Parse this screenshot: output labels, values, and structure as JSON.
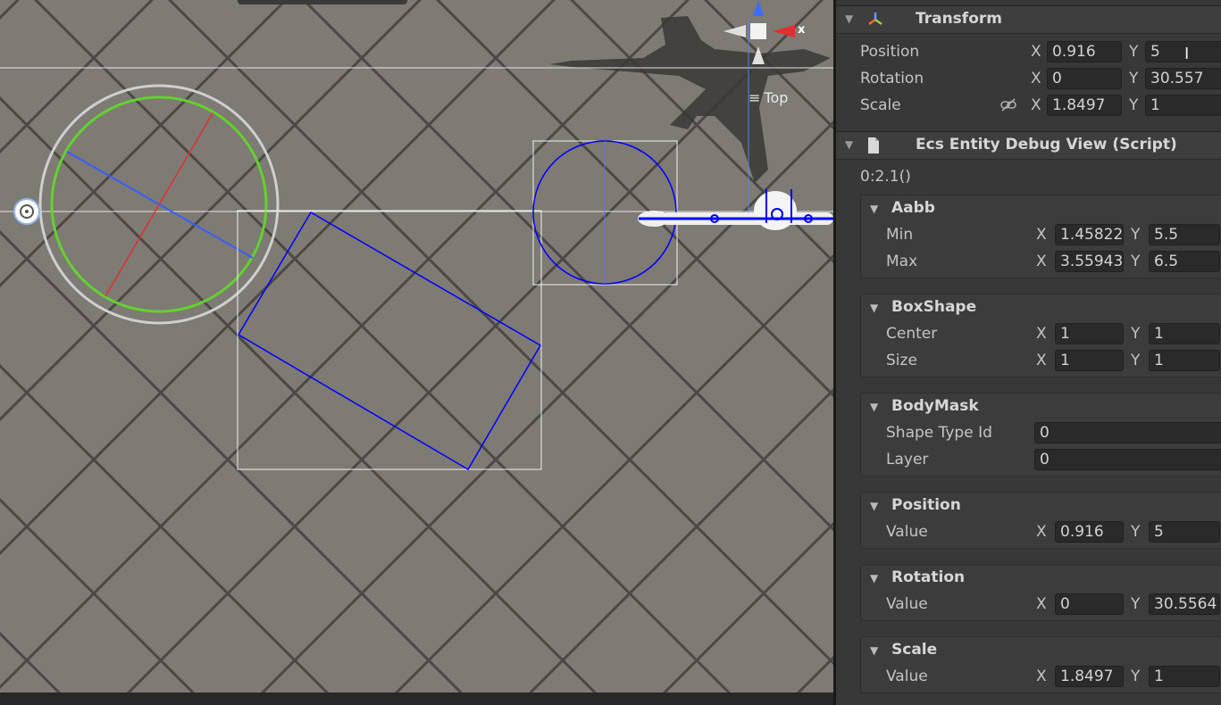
{
  "scene_view": {
    "view_label": "Top",
    "axis_x_label": "x"
  },
  "inspector": {
    "transform": {
      "title": "Transform",
      "rows": [
        {
          "label": "Position",
          "x_label": "X",
          "x": "0.916",
          "y_label": "Y",
          "y": "5"
        },
        {
          "label": "Rotation",
          "x_label": "X",
          "x": "0",
          "y_label": "Y",
          "y": "30.557"
        },
        {
          "label": "Scale",
          "x_label": "X",
          "x": "1.8497",
          "y_label": "Y",
          "y": "1"
        }
      ]
    },
    "debug_view": {
      "title": "Ecs Entity Debug View (Script)",
      "entity_id": "0:2.1()",
      "aabb": {
        "title": "Aabb",
        "min": {
          "label": "Min",
          "x_label": "X",
          "x": "1.45822",
          "y_label": "Y",
          "y": "5.5"
        },
        "max": {
          "label": "Max",
          "x_label": "X",
          "x": "3.55943",
          "y_label": "Y",
          "y": "6.5"
        }
      },
      "box_shape": {
        "title": "BoxShape",
        "center": {
          "label": "Center",
          "x_label": "X",
          "x": "1",
          "y_label": "Y",
          "y": "1"
        },
        "size": {
          "label": "Size",
          "x_label": "X",
          "x": "1",
          "y_label": "Y",
          "y": "1"
        }
      },
      "body_mask": {
        "title": "BodyMask",
        "shape_type_label": "Shape Type Id",
        "shape_type_value": "0",
        "layer_label": "Layer",
        "layer_value": "0"
      },
      "position": {
        "title": "Position",
        "label": "Value",
        "x_label": "X",
        "x": "0.916",
        "y_label": "Y",
        "y": "5"
      },
      "rotation": {
        "title": "Rotation",
        "label": "Value",
        "x_label": "X",
        "x": "0",
        "y_label": "Y",
        "y": "30.5564"
      },
      "scale": {
        "title": "Scale",
        "label": "Value",
        "x_label": "X",
        "x": "1.8497",
        "y_label": "Y",
        "y": "1"
      }
    }
  },
  "icons": [
    "transform-icon",
    "script-icon",
    "foldout-arrow-icon",
    "link-scale-icon",
    "menu-icon",
    "text-cursor-icon",
    "scene-gizmo-icon",
    "camera-gizmo-icon"
  ],
  "colors": {
    "scene_bg": "#7e7a74",
    "inspector_bg": "#383838",
    "gizmo_blue": "#0000ff",
    "collider_green": "#63d12e",
    "axis_red": "#e03030"
  }
}
